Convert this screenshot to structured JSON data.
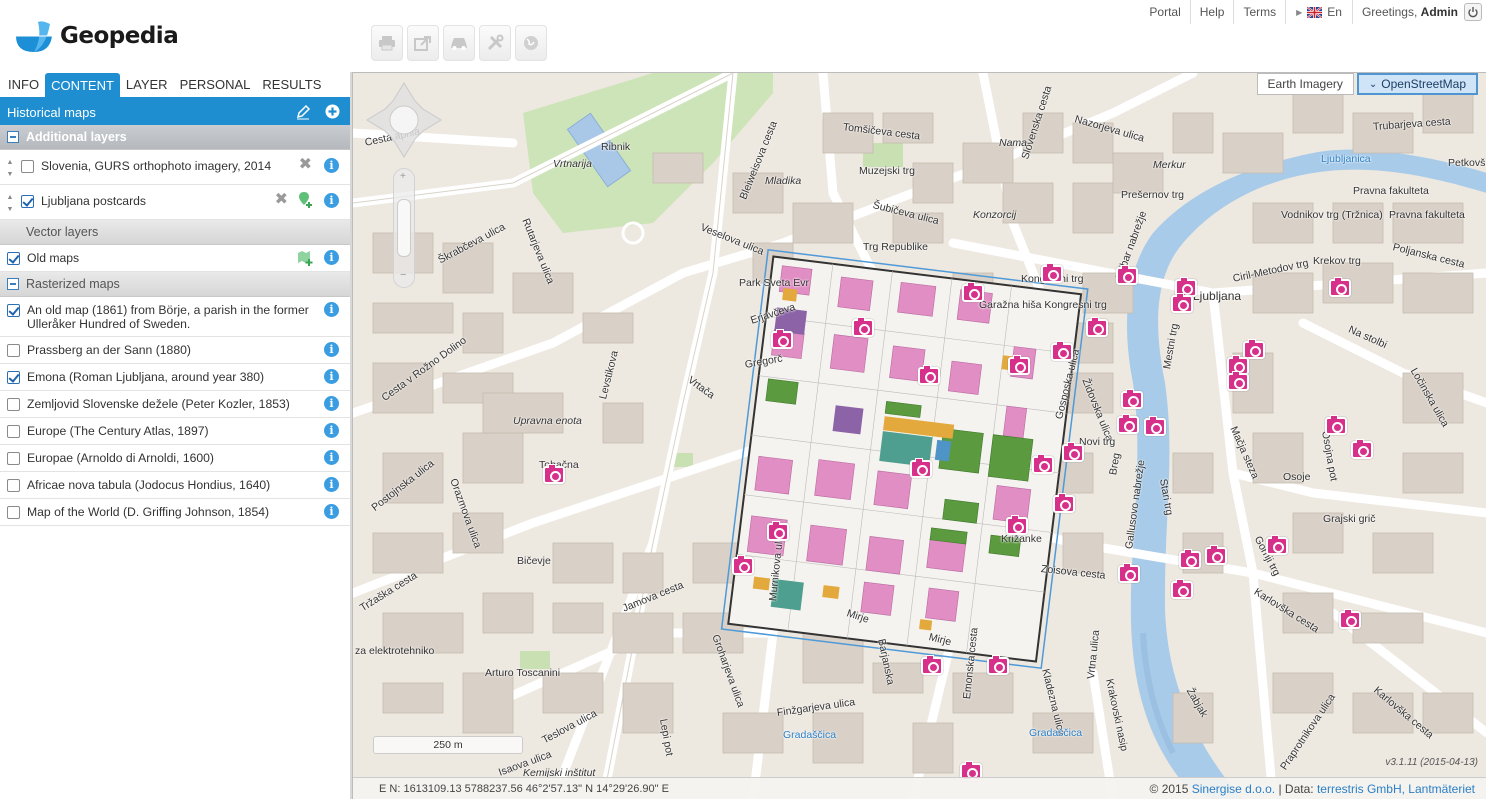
{
  "app": {
    "brand": "Geopedia"
  },
  "toolbar": {
    "buttons": [
      {
        "icon": "print-icon"
      },
      {
        "icon": "share-icon"
      },
      {
        "icon": "car-icon"
      },
      {
        "icon": "tools-icon"
      },
      {
        "icon": "globe-icon"
      }
    ]
  },
  "topnav": {
    "links": [
      "Portal",
      "Help",
      "Terms"
    ],
    "language": "En",
    "greeting_prefix": "Greetings, ",
    "user": "Admin"
  },
  "tabs": [
    "INFO",
    "CONTENT",
    "LAYER",
    "PERSONAL",
    "RESULTS"
  ],
  "active_tab": "CONTENT",
  "panel": {
    "group_title": "Historical maps",
    "sections": {
      "additional": "Additional layers",
      "vector": "Vector layers",
      "rasterized": "Rasterized maps"
    },
    "additional_layers": [
      {
        "label": "Slovenia, GURS orthophoto imagery, 2014",
        "checked": false
      },
      {
        "label": "Ljubljana postcards",
        "checked": true
      }
    ],
    "vector_layers": [
      {
        "label": "Old maps",
        "checked": true
      }
    ],
    "rasterized_maps": [
      {
        "label": "An old map (1861) from Börje, a parish in the former Ulleråker Hundred of Sweden.",
        "checked": true
      },
      {
        "label": "Prassberg an der Sann (1880)",
        "checked": false
      },
      {
        "label": "Emona (Roman Ljubljana, around year 380)",
        "checked": true
      },
      {
        "label": "Zemljovid Slovenske dežele (Peter Kozler, 1853)",
        "checked": false
      },
      {
        "label": "Europe (The Century Atlas, 1897)",
        "checked": false
      },
      {
        "label": "Europae (Arnoldo di Arnoldi, 1600)",
        "checked": false
      },
      {
        "label": "Africae nova tabula (Jodocus Hondius, 1640)",
        "checked": false
      },
      {
        "label": "Map of the World (D. Griffing Johnson, 1854)",
        "checked": false
      }
    ]
  },
  "map": {
    "base_layers": [
      "Earth Imagery",
      "OpenStreetMap"
    ],
    "active_base": "OpenStreetMap",
    "scale": "250 m",
    "version": "v3.1.11 (2015-04-13)",
    "coords": "E N: 1613109.13 5788237.56    46°2'57.13\" N 14°29'26.90\" E",
    "copyright_prefix": "© 2015 ",
    "copyright_company": "Sinergise d.o.o.",
    "copyright_data_prefix": " | Data: ",
    "copyright_data": "terrestris GmbH, Lantmäteriet",
    "labels": {
      "cesta_aprila": "Cesta    aprila",
      "vrtnarija": "Vrtnarija",
      "ribnik": "Ribnik",
      "bleiweisova": "Bleiweisova cesta",
      "tomsiceva": "Tomšičeva cesta",
      "slovenska": "Slovenska cesta",
      "nazorjeva": "Nazorjeva ulica",
      "trubarjeva": "Trubarjeva cesta",
      "mladika": "Mladika",
      "muzejski": "Muzejski trg",
      "nama": "Nama",
      "merkur": "Merkur",
      "ljubljanica1": "Ljubljanica",
      "petkovs": "Petkovš",
      "presernov": "Prešernov trg",
      "pravna1": "Pravna fakulteta",
      "vodnikov": "Vodnikov trg (Tržnica)",
      "pravna2": "Pravna fakulteta",
      "subiceva": "Šubičeva ulica",
      "konzorcij": "Konzorcij",
      "trg_republike": "Trg Republike",
      "skrabceva": "Škrabčeva ulica",
      "rutarjeva": "Rutarjeva ulica",
      "veselova": "Veselova ulica",
      "kongresni": "Kongresni trg",
      "ciril": "Ciril-Metodov trg",
      "poljanska": "Poljanska cesta",
      "krekov": "Krekov trg",
      "park_sveta": "Park Sveta Evr",
      "garazna": "Garažna hiša Kongresni trg",
      "ljubljana": "Ljubljana",
      "erjavceva": "Erjavčeva",
      "hribar": "Hribar nabrežje",
      "na_stolbi": "Na stolbi",
      "cesta_v_roznodolino": "Cesta v Rožno Dolino",
      "levstikova": "Levstikova",
      "gregorc": "Gregorč",
      "vrtaca": "Vrtača",
      "gosposka": "Gosposka ulica",
      "zidovska": "Židovska ulica",
      "mestni": "Mestni trg",
      "upravna": "Upravna enota",
      "novi_trg": "Novi trg",
      "breg": "Breg",
      "stari_trg": "Stari trg",
      "macja": "Mačja steza",
      "osojna": "Osojna pot",
      "osoje": "Osoje",
      "tobacna": "Tobačna",
      "postojnska": "Postojnska ulica",
      "orazmova": "Orazmova ulica",
      "gallusovo": "Gallusovo nabrežje",
      "grajski": "Grajski grič",
      "trzaska": "Tržaška cesta",
      "bicevje": "Bičevje",
      "jamova": "Jamova cesta",
      "zoisova": "Zoisova cesta",
      "gornji": "Gornji trg",
      "karlovska": "Karlovška cesta",
      "elektro": "za elektrotehniko",
      "toscanini": "Arturo Toscanini",
      "murnikova": "Murnikova ulica",
      "groharjeva": "Groharjeva ulica",
      "mirje1": "Mirje",
      "mirje2": "Mirje",
      "barjanska": "Barjanska",
      "emonska": "Emonska cesta",
      "krakovski": "Krakovski nasip",
      "vrtna": "Vrtna ulica",
      "kladezna": "Kladezna ulica",
      "zabjak": "Žabjak",
      "praprotnikova": "Praprotnikova ulica",
      "karlovska2": "Karlovška cesta",
      "tesliva": "Teslova ulica",
      "lepi": "Lepi pot",
      "finzgarjeva": "Finžgarjeva ulica",
      "gradascica1": "Gradaščica",
      "gradascica2": "Gradaščica",
      "isaova": "Isaova ulica",
      "kemijski": "Kemijski inštitut",
      "krizanke": "Križanke",
      "lonjska": "Ločinska ulica"
    }
  }
}
